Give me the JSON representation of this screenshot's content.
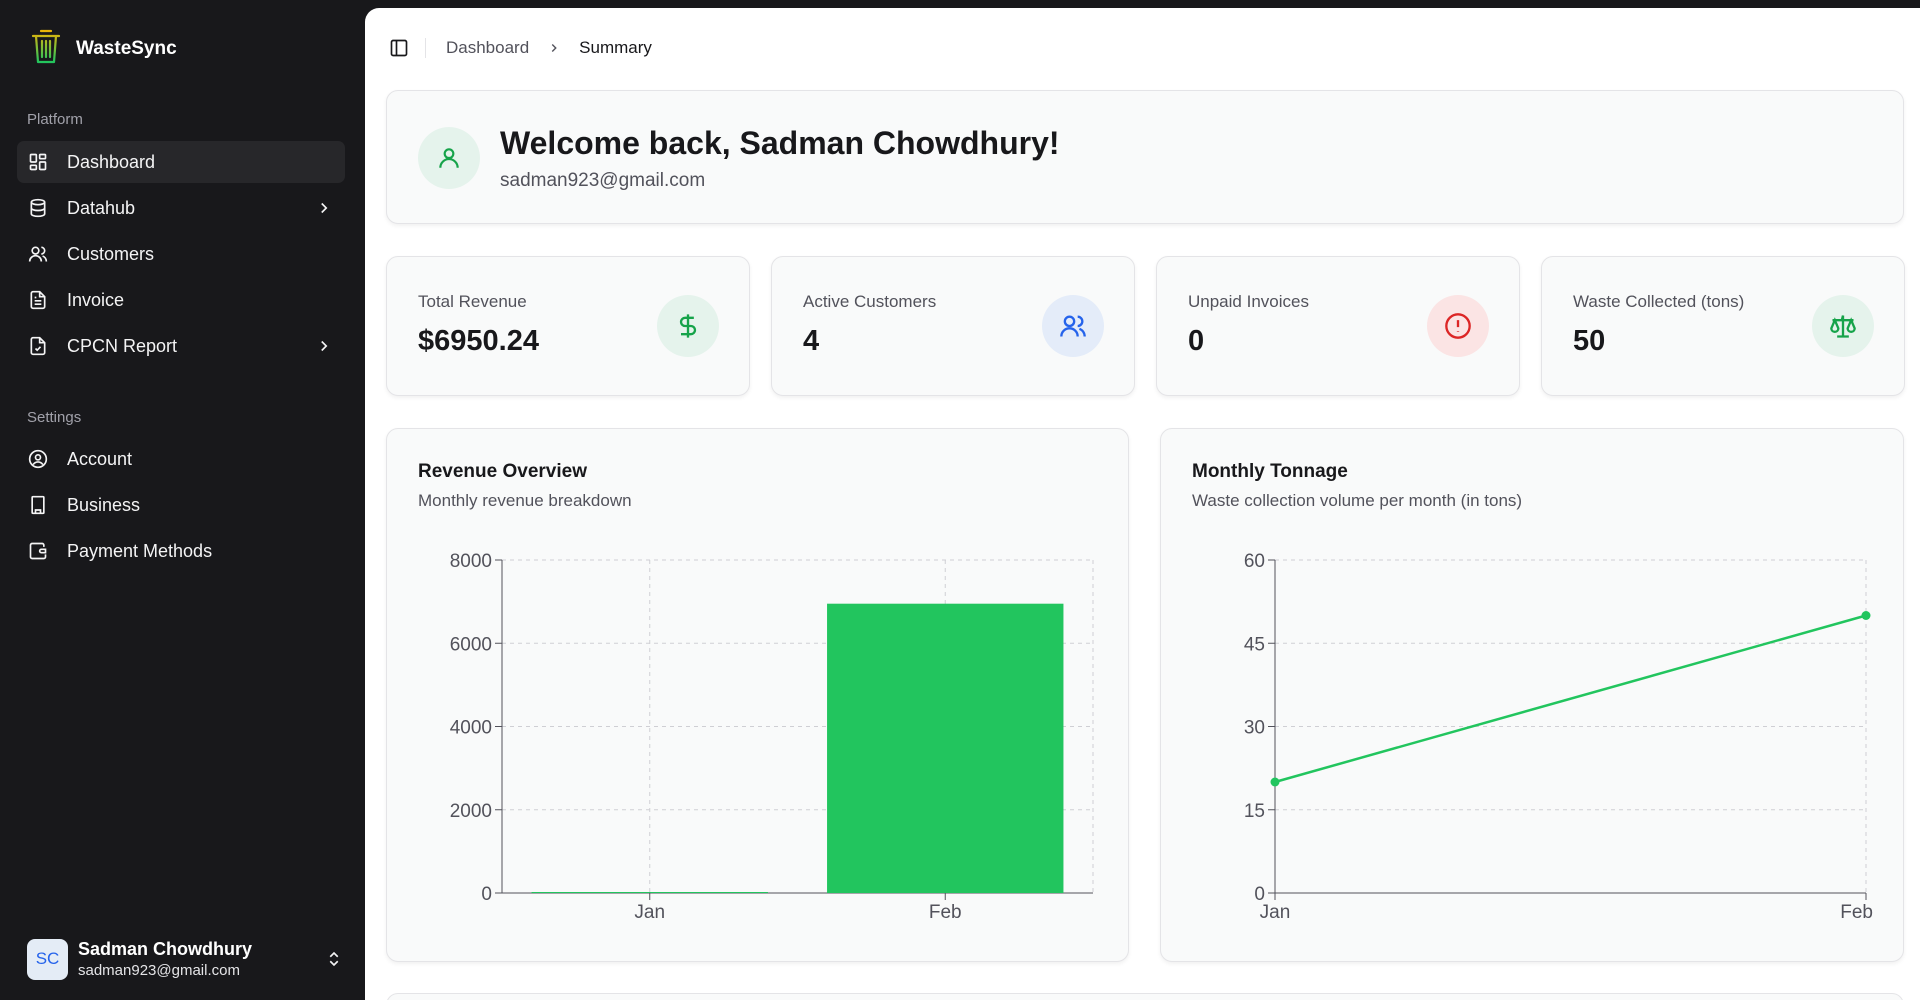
{
  "app": {
    "name": "WasteSync"
  },
  "sidebar": {
    "platform_label": "Platform",
    "settings_label": "Settings",
    "platform_items": [
      {
        "label": "Dashboard",
        "icon": "dashboard-icon",
        "active": true
      },
      {
        "label": "Datahub",
        "icon": "database-icon",
        "has_submenu": true
      },
      {
        "label": "Customers",
        "icon": "users-icon"
      },
      {
        "label": "Invoice",
        "icon": "file-text-icon"
      },
      {
        "label": "CPCN Report",
        "icon": "file-check-icon",
        "has_submenu": true
      }
    ],
    "settings_items": [
      {
        "label": "Account",
        "icon": "user-circle-icon"
      },
      {
        "label": "Business",
        "icon": "building-icon"
      },
      {
        "label": "Payment Methods",
        "icon": "wallet-icon"
      }
    ],
    "user": {
      "initials": "SC",
      "name": "Sadman Chowdhury",
      "email": "sadman923@gmail.com"
    }
  },
  "breadcrumb": {
    "parent": "Dashboard",
    "current": "Summary"
  },
  "welcome": {
    "title": "Welcome back, Sadman Chowdhury!",
    "email": "sadman923@gmail.com"
  },
  "stats": [
    {
      "title": "Total Revenue",
      "value": "$6950.24",
      "icon": "dollar-icon",
      "color": "#16a34a",
      "bg": "#e5f3ec"
    },
    {
      "title": "Active Customers",
      "value": "4",
      "icon": "users-icon",
      "color": "#2563eb",
      "bg": "#e4ecf9"
    },
    {
      "title": "Unpaid Invoices",
      "value": "0",
      "icon": "alert-circle-icon",
      "color": "#dc2626",
      "bg": "#fbe4e4"
    },
    {
      "title": "Waste Collected (tons)",
      "value": "50",
      "icon": "scale-icon",
      "color": "#16a34a",
      "bg": "#e5f3ec"
    }
  ],
  "charts": {
    "revenue": {
      "title": "Revenue Overview",
      "subtitle": "Monthly revenue breakdown"
    },
    "tonnage": {
      "title": "Monthly Tonnage",
      "subtitle": "Waste collection volume per month (in tons)"
    }
  },
  "colors": {
    "accent": "#22c55e",
    "sidebar_bg": "#18181b"
  },
  "chart_data": [
    {
      "type": "bar",
      "title": "Revenue Overview",
      "categories": [
        "Jan",
        "Feb"
      ],
      "values": [
        0,
        6950.24
      ],
      "ylim": [
        0,
        8000
      ],
      "yticks": [
        0,
        2000,
        4000,
        6000,
        8000
      ],
      "grid": true,
      "color": "#22c55e"
    },
    {
      "type": "line",
      "title": "Monthly Tonnage",
      "x": [
        "Jan",
        "Feb"
      ],
      "values": [
        20,
        50
      ],
      "ylim": [
        0,
        60
      ],
      "yticks": [
        0,
        15,
        30,
        45,
        60
      ],
      "grid": true,
      "color": "#22c55e"
    }
  ]
}
